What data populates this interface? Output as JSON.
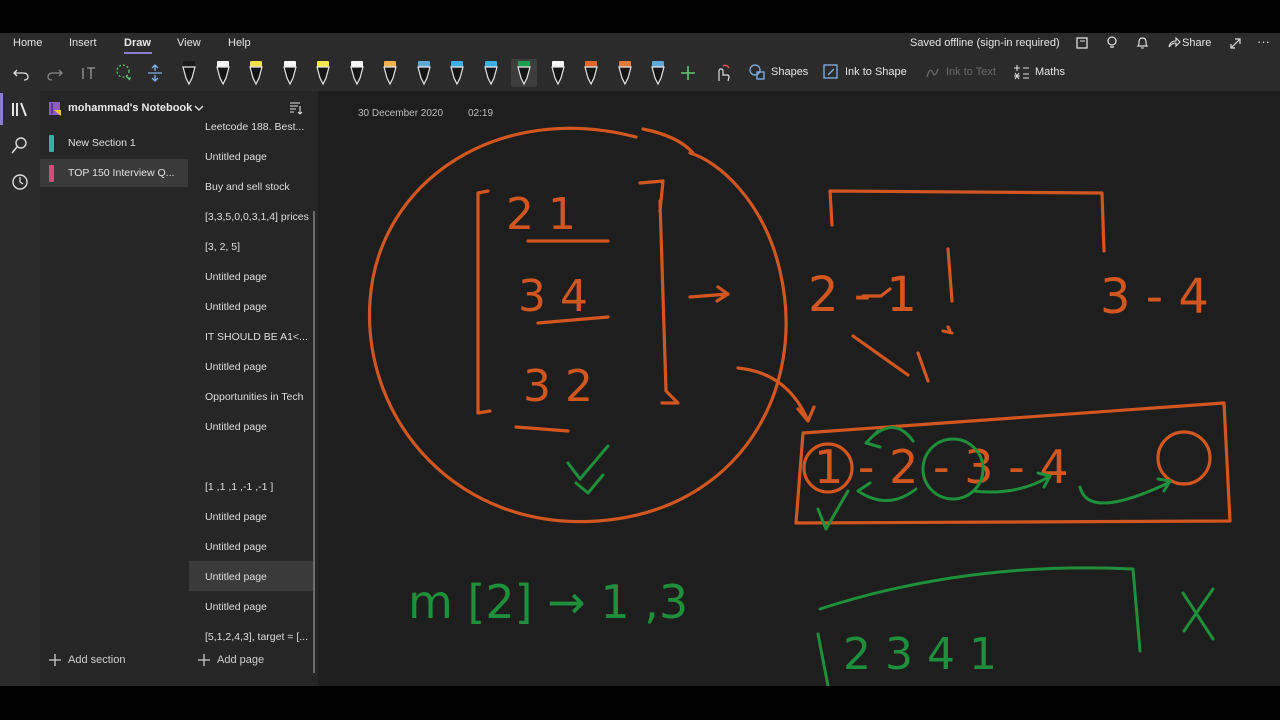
{
  "menu": [
    "Home",
    "Insert",
    "Draw",
    "View",
    "Help"
  ],
  "status": {
    "saved": "Saved offline (sign-in required)",
    "share": "Share"
  },
  "toolbar": {
    "shapes": "Shapes",
    "ink_to_shape": "Ink to Shape",
    "ink_to_text": "Ink to Text",
    "maths": "Maths",
    "pen_colors": [
      "#1a1a1a",
      "#f5f5f5",
      "#f2e04a",
      "#f5f5f5",
      "#f4e84c",
      "#f5f5f5",
      "#f2b24a",
      "#5fa9d8",
      "#3ab0e4",
      "#3ab0e4",
      "#1f9d4e",
      "#f5f5f5",
      "#e0662a",
      "#e07a3a",
      "#5fa9d8"
    ]
  },
  "notebook": {
    "title": "mohammad's Notebook"
  },
  "sections": [
    {
      "label": "New Section 1",
      "color": "#2fb5a3"
    },
    {
      "label": "TOP 150 Interview Q...",
      "color": "#d94a7b"
    }
  ],
  "pages": [
    "Leetcode 188. Best...",
    "Untitled page",
    "Buy and sell stock",
    "[3,3,5,0,0,3,1,4] prices",
    "[3, 2, 5]",
    "Untitled page",
    "Untitled page",
    "IT SHOULD BE A1<...",
    "Untitled page",
    "Opportunities in Tech",
    "Untitled page",
    "",
    "[1 ,1 ,1 ,-1 ,-1 ]",
    "Untitled page",
    "Untitled page",
    "Untitled page",
    "Untitled page",
    "[5,1,2,4,3], target = [..."
  ],
  "add_section": "Add section",
  "add_page": "Add page",
  "page_meta": {
    "date": "30 December 2020",
    "time": "02:19"
  },
  "ink": {
    "matrix": [
      "2 1",
      "3 4",
      "3 2"
    ],
    "pair_left": "2 - 1",
    "pair_right": "3 - 4",
    "chain": "1 - 2 - 3 - 4",
    "result_note": "m [2] → 1 ,3",
    "wrong_order": "2 3 4 1",
    "ink_orange": "#d2561f",
    "ink_green": "#1e8f3a"
  }
}
